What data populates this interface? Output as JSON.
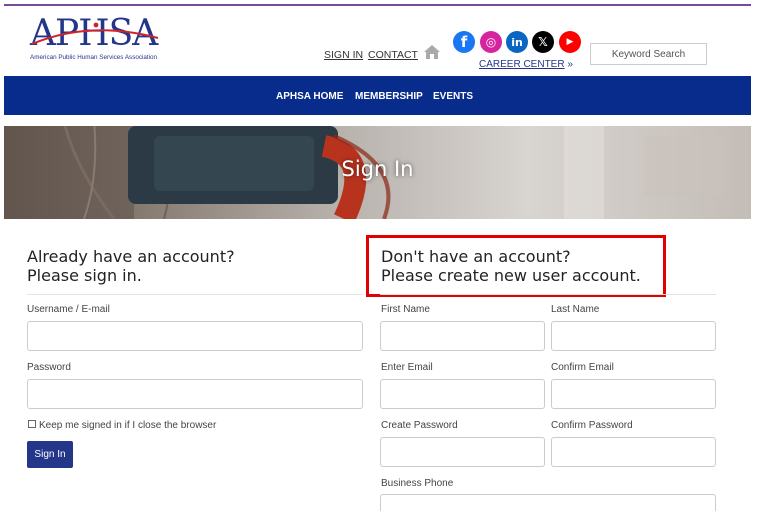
{
  "brand": {
    "logo_text": "APHSA",
    "logo_subtitle": "American Public Human Services Association",
    "primary_color": "#23368a",
    "nav_color": "#082c8c"
  },
  "header": {
    "links": [
      "SIGN IN",
      "CONTACT"
    ],
    "career_label": "CAREER CENTER",
    "career_suffix": "»",
    "search_placeholder": "Keyword Search",
    "social": [
      {
        "name": "facebook-icon",
        "glyph": "f",
        "color": "#1877f2"
      },
      {
        "name": "instagram-icon",
        "glyph": "◎",
        "color": "#d6249f"
      },
      {
        "name": "linkedin-icon",
        "glyph": "in",
        "color": "#0a66c2"
      },
      {
        "name": "x-icon",
        "glyph": "𝕏",
        "color": "#000000"
      },
      {
        "name": "youtube-icon",
        "glyph": "▶",
        "color": "#ff0000"
      }
    ]
  },
  "nav": {
    "items": [
      "APHSA HOME",
      "MEMBERSHIP",
      "EVENTS"
    ]
  },
  "hero": {
    "title": "Sign In"
  },
  "signin": {
    "heading_line1": "Already have an account?",
    "heading_line2": "Please sign in.",
    "username_label": "Username / E-mail",
    "password_label": "Password",
    "remember_label": "Keep me signed in if I close the browser",
    "button_label": "Sign In"
  },
  "register": {
    "heading_line1": "Don't have an account?",
    "heading_line2": "Please create new user account.",
    "first_name_label": "First Name",
    "last_name_label": "Last Name",
    "email_label": "Enter Email",
    "confirm_email_label": "Confirm Email",
    "password_label": "Create Password",
    "confirm_password_label": "Confirm Password",
    "business_phone_label": "Business Phone",
    "highlight_color": "#e00000"
  }
}
